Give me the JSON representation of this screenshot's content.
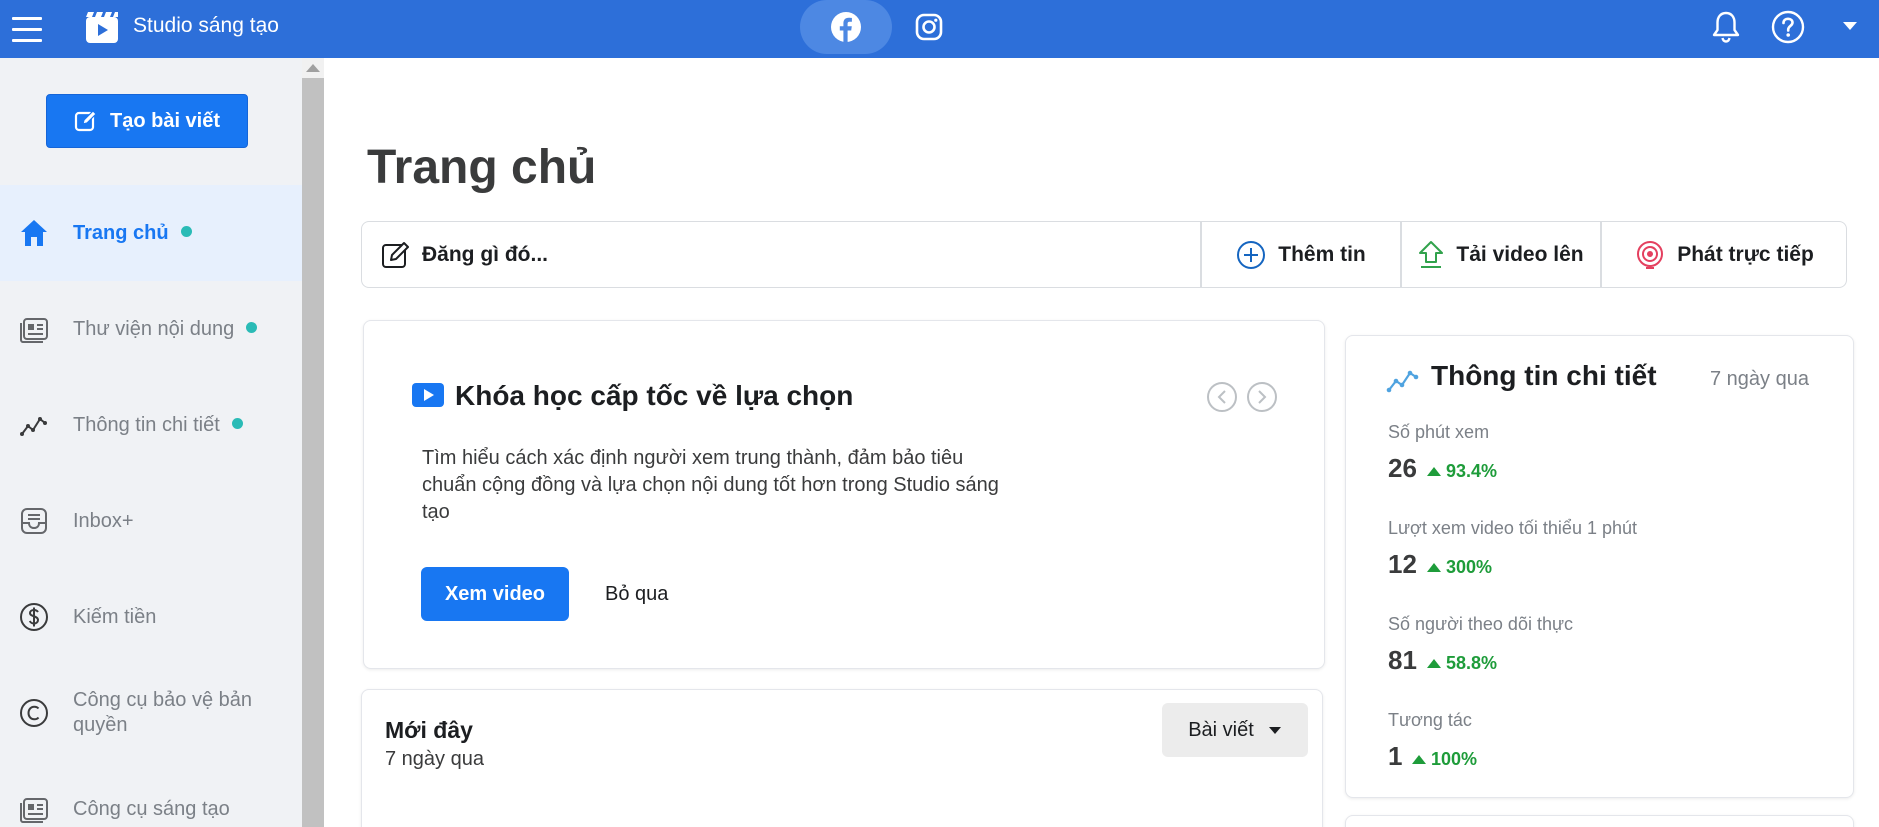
{
  "topbar": {
    "app_title": "Studio sáng tạo",
    "background": "#2d6fd9",
    "tabs": [
      {
        "icon": "facebook-icon",
        "active": true
      },
      {
        "icon": "instagram-icon",
        "active": false
      }
    ],
    "icons": [
      "bell-icon",
      "help-icon",
      "caret-down-icon"
    ]
  },
  "sidebar": {
    "create_button": "Tạo bài viết",
    "items": [
      {
        "label": "Trang chủ",
        "icon": "home-icon",
        "active": true,
        "dot": true
      },
      {
        "label": "Thư viện nội dung",
        "icon": "content-library-icon",
        "active": false,
        "dot": true
      },
      {
        "label": "Thông tin chi tiết",
        "icon": "insights-icon",
        "active": false,
        "dot": true
      },
      {
        "label": "Inbox+",
        "icon": "inbox-icon",
        "active": false,
        "dot": false
      },
      {
        "label": "Kiếm tiền",
        "icon": "dollar-icon",
        "active": false,
        "dot": false
      },
      {
        "label": "Công cụ bảo vệ bản quyền",
        "icon": "copyright-icon",
        "active": false,
        "dot": false
      },
      {
        "label": "Công cụ sáng tạo",
        "icon": "creative-tools-icon",
        "active": false,
        "dot": false
      }
    ]
  },
  "main": {
    "title": "Trang chủ",
    "composer": {
      "post_label": "Đăng gì đó...",
      "actions": [
        {
          "label": "Thêm tin",
          "icon": "plus-circle-icon"
        },
        {
          "label": "Tải video lên",
          "icon": "upload-icon"
        },
        {
          "label": "Phát trực tiếp",
          "icon": "live-icon"
        }
      ]
    },
    "course": {
      "title": "Khóa học cấp tốc về lựa chọn",
      "description": "Tìm hiểu cách xác định người xem trung thành, đảm bảo tiêu chuẩn cộng đồng và lựa chọn nội dung tốt hơn trong Studio sáng tạo",
      "primary_button": "Xem video",
      "secondary_button": "Bỏ qua"
    },
    "recent": {
      "title": "Mới đây",
      "subtitle": "7 ngày qua",
      "dropdown": "Bài viết"
    },
    "insights": {
      "title": "Thông tin chi tiết",
      "range": "7 ngày qua",
      "metrics": [
        {
          "label": "Số phút xem",
          "value": "26",
          "change": "93.4%"
        },
        {
          "label": "Lượt xem video tối thiểu 1 phút",
          "value": "12",
          "change": "300%"
        },
        {
          "label": "Số người theo dõi thực",
          "value": "81",
          "change": "58.8%"
        },
        {
          "label": "Tương tác",
          "value": "1",
          "change": "100%"
        }
      ]
    }
  },
  "colors": {
    "accent": "#1877f2",
    "topbar": "#2d6fd9",
    "dot": "#2abbb6",
    "positive": "#1e9c3a",
    "sidebar_bg": "#f0f2f5"
  }
}
